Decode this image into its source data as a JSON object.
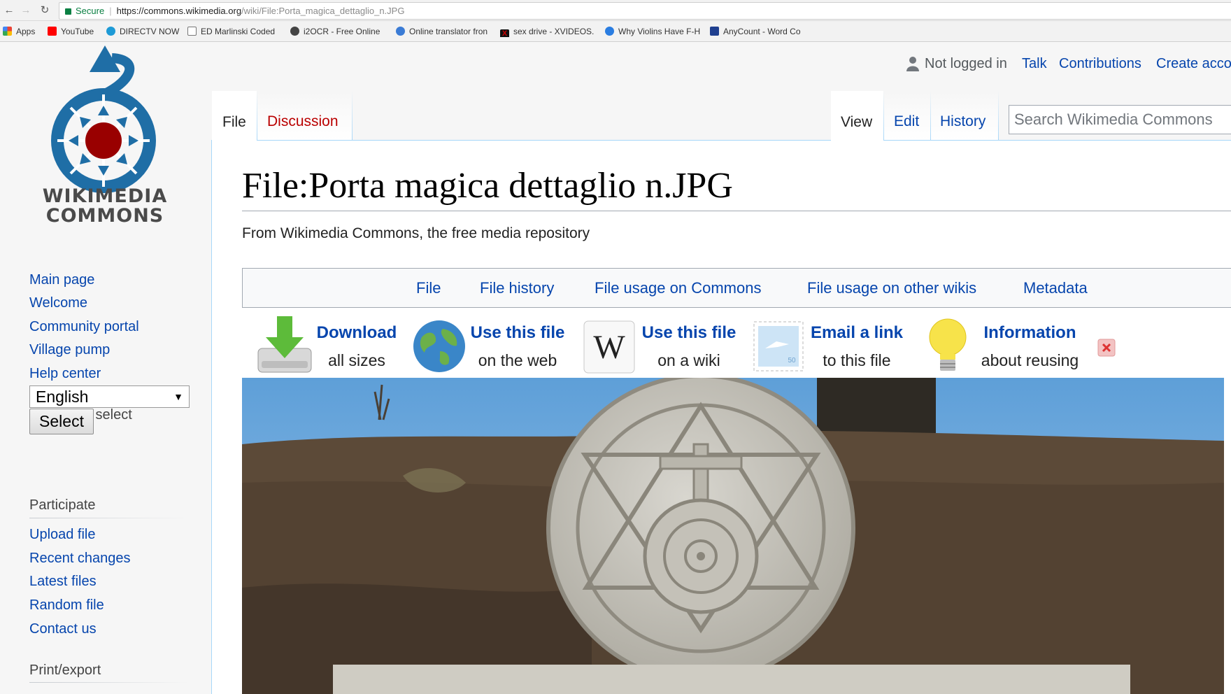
{
  "browser": {
    "secure_label": "Secure",
    "url_host": "https://commons.wikimedia.org",
    "url_path": "/wiki/File:Porta_magica_dettaglio_n.JPG"
  },
  "bookmarks": [
    {
      "label": "Apps",
      "icon": "apps-grid-icon",
      "color": "#e94235"
    },
    {
      "label": "YouTube",
      "icon": "youtube-icon",
      "color": "#ff0000"
    },
    {
      "label": "DIRECTV NOW",
      "icon": "directv-icon",
      "color": "#1d9ad6"
    },
    {
      "label": "ED Marlinski Coded",
      "icon": "page-icon",
      "color": "#ffffff"
    },
    {
      "label": "i2OCR - Free Online",
      "icon": "i2ocr-icon",
      "color": "#444444"
    },
    {
      "label": "Online translator fron",
      "icon": "translator-icon",
      "color": "#3a7bd5"
    },
    {
      "label": "sex drive - XVIDEOS.C",
      "icon": "xvideos-icon",
      "color": "#cc0000"
    },
    {
      "label": "Why Violins Have F-H",
      "icon": "violin-site-icon",
      "color": "#2a7de1"
    },
    {
      "label": "AnyCount - Word Co",
      "icon": "anycount-icon",
      "color": "#1f3f8f"
    }
  ],
  "logo": {
    "line1": "WIKIMEDIA",
    "line2": "COMMONS"
  },
  "sidebar": {
    "nav": [
      "Main page",
      "Welcome",
      "Community portal",
      "Village pump",
      "Help center"
    ],
    "language_heading": "Language select",
    "language_value": "English",
    "select_button": "Select",
    "participate_heading": "Participate",
    "participate": [
      "Upload file",
      "Recent changes",
      "Latest files",
      "Random file",
      "Contact us"
    ],
    "print_heading": "Print/export"
  },
  "personal": {
    "not_logged_in": "Not logged in",
    "talk": "Talk",
    "contributions": "Contributions",
    "create_account": "Create account"
  },
  "tabs": {
    "file": "File",
    "discussion": "Discussion",
    "view": "View",
    "edit": "Edit",
    "history": "History"
  },
  "search": {
    "placeholder": "Search Wikimedia Commons"
  },
  "page": {
    "title": "File:Porta magica dettaglio n.JPG",
    "tagline": "From Wikimedia Commons, the free media repository"
  },
  "file_toc": [
    "File",
    "File history",
    "File usage on Commons",
    "File usage on other wikis",
    "Metadata"
  ],
  "tools": [
    {
      "title": "Download",
      "sub": "all sizes"
    },
    {
      "title": "Use this file",
      "sub": "on the web"
    },
    {
      "title": "Use this file",
      "sub": "on a wiki"
    },
    {
      "title": "Email a link",
      "sub": "to this file"
    },
    {
      "title": "Information",
      "sub": "about reusing"
    }
  ],
  "colors": {
    "link": "#0645ad",
    "new_link": "#ba0000",
    "border": "#a7d7f9"
  }
}
